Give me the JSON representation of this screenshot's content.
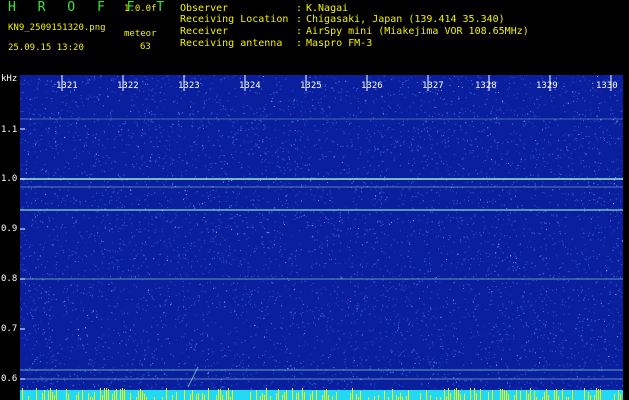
{
  "header": {
    "app_title": "H R O F F T",
    "app_version": "1.0.0f",
    "file_name": "KN9_2509151320.png",
    "meteor_label": "meteor",
    "meteor_count": "63",
    "date_time": "25.09.15 13:20",
    "info": [
      {
        "label": "Observer",
        "sep": ":",
        "value": "K.Nagai"
      },
      {
        "label": "Receiving Location",
        "sep": ":",
        "value": "Chigasaki, Japan (139.414 35.340)"
      },
      {
        "label": "Receiver",
        "sep": ":",
        "value": "AirSpy mini (Miakejima VOR 108.65MHz)"
      },
      {
        "label": "Receiving antenna",
        "sep": ":",
        "value": "Maspro FM-3"
      }
    ]
  },
  "axes": {
    "y_unit": "kHz",
    "y_ticks": [
      "1.1",
      "1.0",
      "0.9",
      "0.8",
      "0.7",
      "0.6"
    ],
    "x_ticks": [
      "1321",
      "1322",
      "1323",
      "1324",
      "1325",
      "1326",
      "1327",
      "1328",
      "1329",
      "1330"
    ]
  },
  "colors": {
    "background": "#000000",
    "plot_background": "#0a1f9e",
    "title": "#39e639",
    "yellow_text": "#f2f200",
    "trace": "#9ff5d0",
    "bottom_band": "#22d8f2"
  }
}
